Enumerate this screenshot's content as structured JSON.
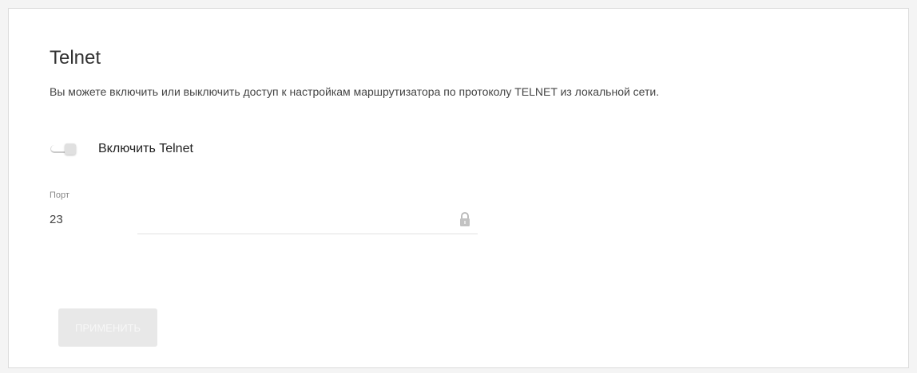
{
  "section": {
    "title": "Telnet",
    "description": "Вы можете включить или выключить доступ к настройкам маршрутизатора по протоколу TELNET из локальной сети."
  },
  "telnet_toggle": {
    "label": "Включить Telnet",
    "enabled": false
  },
  "port_field": {
    "label": "Порт",
    "value": "23",
    "locked_icon": "lock-icon"
  },
  "actions": {
    "apply_label": "ПРИМЕНИТЬ"
  },
  "colors": {
    "background": "#f4f4f4",
    "panel": "#ffffff",
    "text": "#333333",
    "muted": "#888888",
    "button_disabled": "#e8e8e8"
  }
}
